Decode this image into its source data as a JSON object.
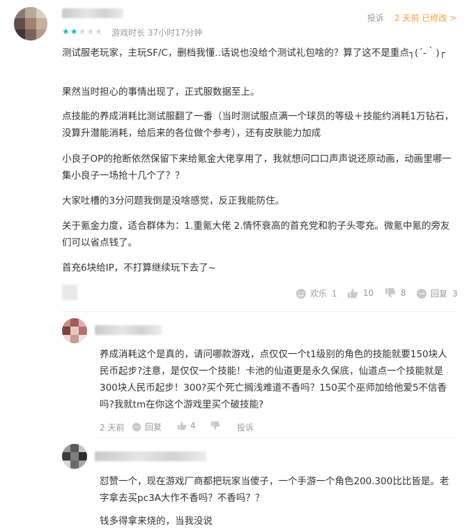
{
  "review": {
    "report_label": "投诉",
    "time_label": "2 天前 已修改 >",
    "playtime": "游戏时长 37小时17分钟",
    "rating_stars": 2,
    "rating_max": 5,
    "paragraphs": [
      "测试服老玩家，主玩SF/C，删档我懂..话说也没给个测试礼包啥的？算了这不是重点┐(´-｀)┌",
      "果然当时担心的事情出现了，正式服数据至上。",
      "点技能的养成消耗比测试服翻了一番（当时测试服点满一个球员的等级＋技能约消耗1万钻石，没算升潜能消耗，给后来的各位做个参考），还有皮肤能力加成",
      "小良子OP的抢断依然保留下来给氪金大佬享用了，我就想问口口声声说还原动画，动画里哪一集小良子一场抢十几个了？？",
      "大家吐槽的3分问题我倒是没啥感觉，反正我能防住。",
      "关于氪金力度，适合群体为：1.重氪大佬 2.情怀衰高的首充党和豹子头零充。微氪中氪的旁友们可以省点钱了。",
      "首充6块给IP，不打算继续玩下去了~"
    ],
    "actions": {
      "happy_label": "欢乐",
      "happy_count": "1",
      "like_count": "10",
      "dislike_count": "8",
      "reply_label": "回复",
      "reply_count": "3"
    }
  },
  "reply1": {
    "text": "养成消耗这个是真的，请问哪款游戏，点仅仅一个t1级别的角色的技能就要150块人民币起步?注意，是仅仅一个技能！卡池的仙道更是永久保底，仙道点一个技能就是300块人民币起步！300?买个死亡搁浅难道不香吗？150买个巫师加给他爱5不信香吗?我就tm在你这个游戏里买个破技能?",
    "time": "2 天前",
    "reply_label": "回复",
    "like_count": "4",
    "report_label": "投诉"
  },
  "reply2": {
    "paragraphs": [
      "怼赞一个，现在游戏厂商都把玩家当傻子，一个手游一个角色200.300比比皆是。老字拿去买pc3A大作不香吗？不香吗？？",
      "钱多得拿来烧的，当我没说"
    ]
  },
  "colors": {
    "accent": "#14b9c8",
    "muted": "#999999",
    "text": "#333333"
  }
}
